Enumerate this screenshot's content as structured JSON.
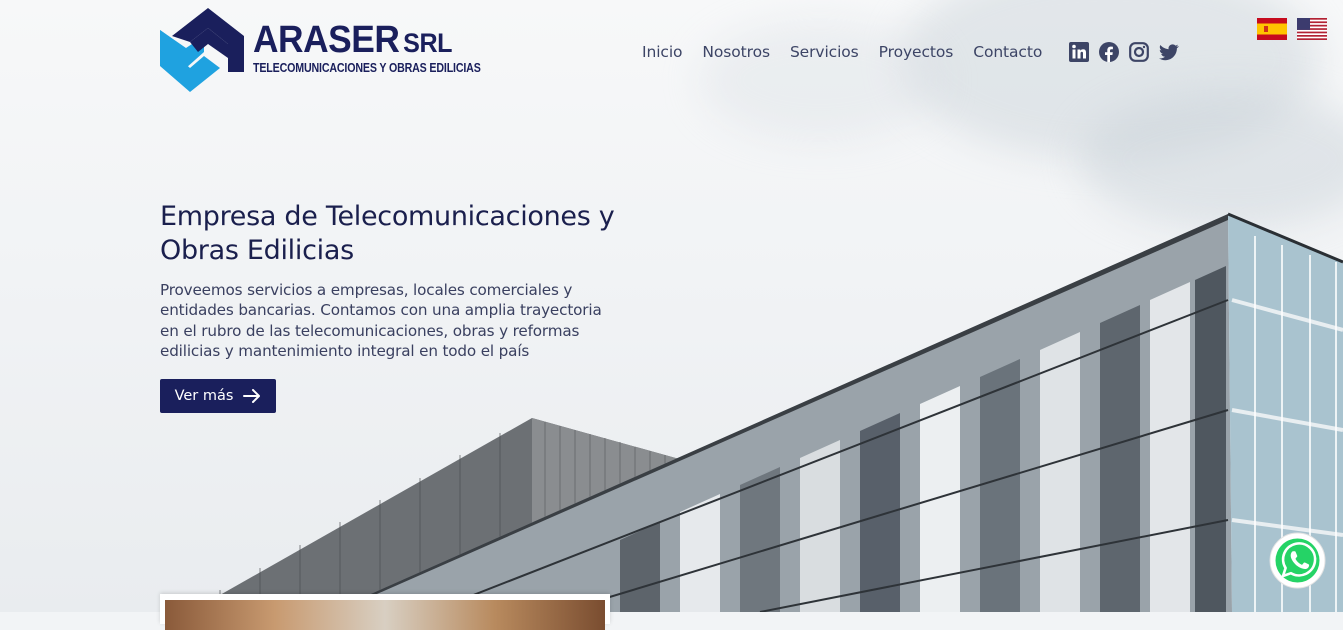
{
  "brand": {
    "name": "ARASER",
    "suffix": "SRL",
    "tagline": "TELECOMUNICACIONES Y OBRAS EDILICIAS",
    "colors": {
      "navy": "#1a1f5c",
      "sky": "#1fa2e0"
    }
  },
  "nav": {
    "items": [
      {
        "label": "Inicio"
      },
      {
        "label": "Nosotros"
      },
      {
        "label": "Servicios"
      },
      {
        "label": "Proyectos"
      },
      {
        "label": "Contacto"
      }
    ]
  },
  "social": [
    "linkedin-icon",
    "facebook-icon",
    "instagram-icon",
    "twitter-icon"
  ],
  "languages": [
    "spain-flag",
    "usa-flag"
  ],
  "hero": {
    "title": "Empresa de Telecomunicaciones y Obras Edilicias",
    "description": "Proveemos servicios a empresas, locales comerciales y entidades bancarias. Contamos con una amplia trayectoria en el rubro de las telecomunicaciones, obras y reformas edilicias y mantenimiento integral en todo el país",
    "cta_label": "Ver más"
  },
  "floating": {
    "whatsapp": "whatsapp-icon"
  }
}
